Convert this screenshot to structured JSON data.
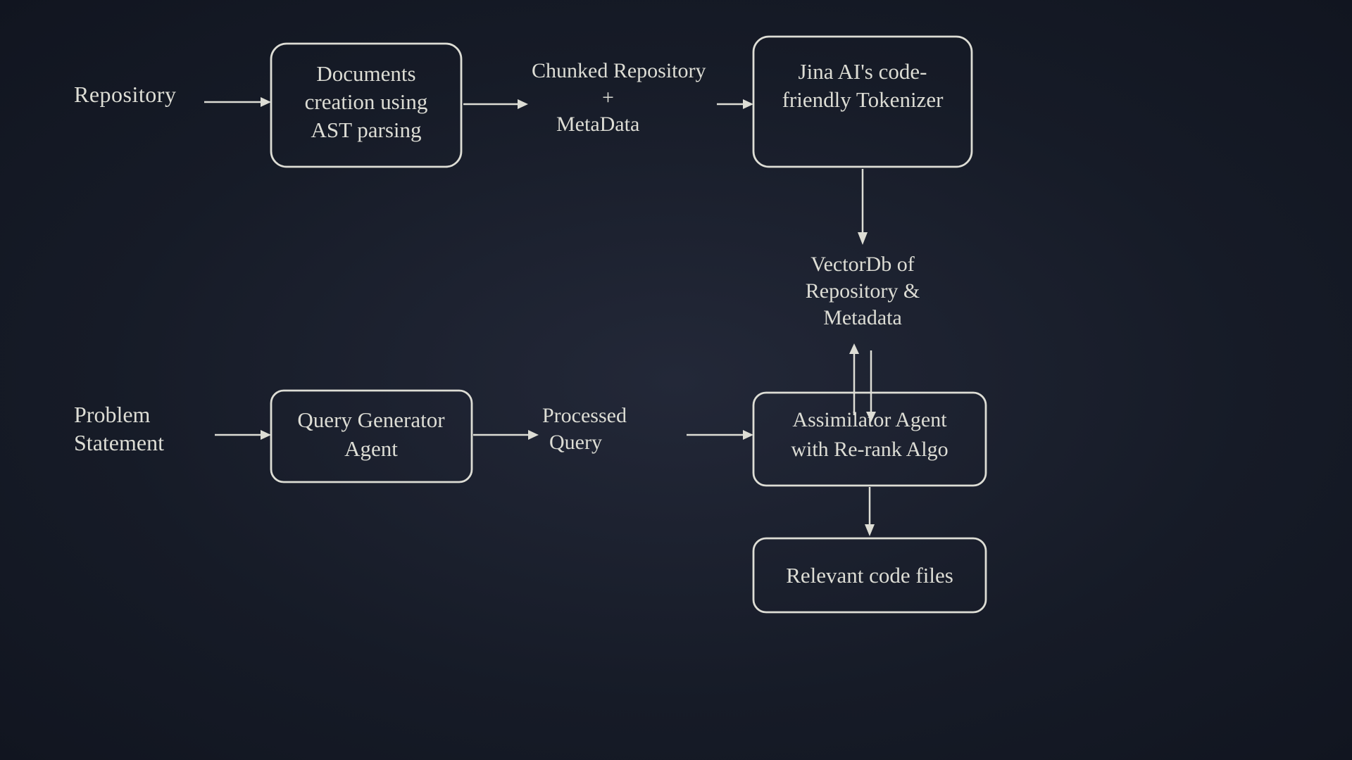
{
  "diagram": {
    "background": "#1a1f2e",
    "nodes": {
      "repository_label": "Repository",
      "docs_creation_box": "Documents\ncreation using\nAST parsing",
      "chunked_label": "Chunked Repository\n+\nMetaData",
      "jina_box": "Jina AI's code-\nfriendly Tokenizer",
      "vectordb_label": "VectorDb of\nRepository &\nMetadata",
      "problem_label": "Problem\nStatement",
      "query_gen_box": "Query Generator\nAgent",
      "processed_label": "Processed\nQuery",
      "assimilator_box": "Assimilator Agent\nwith Re-rank Algo",
      "relevant_box": "Relevant code files"
    }
  }
}
